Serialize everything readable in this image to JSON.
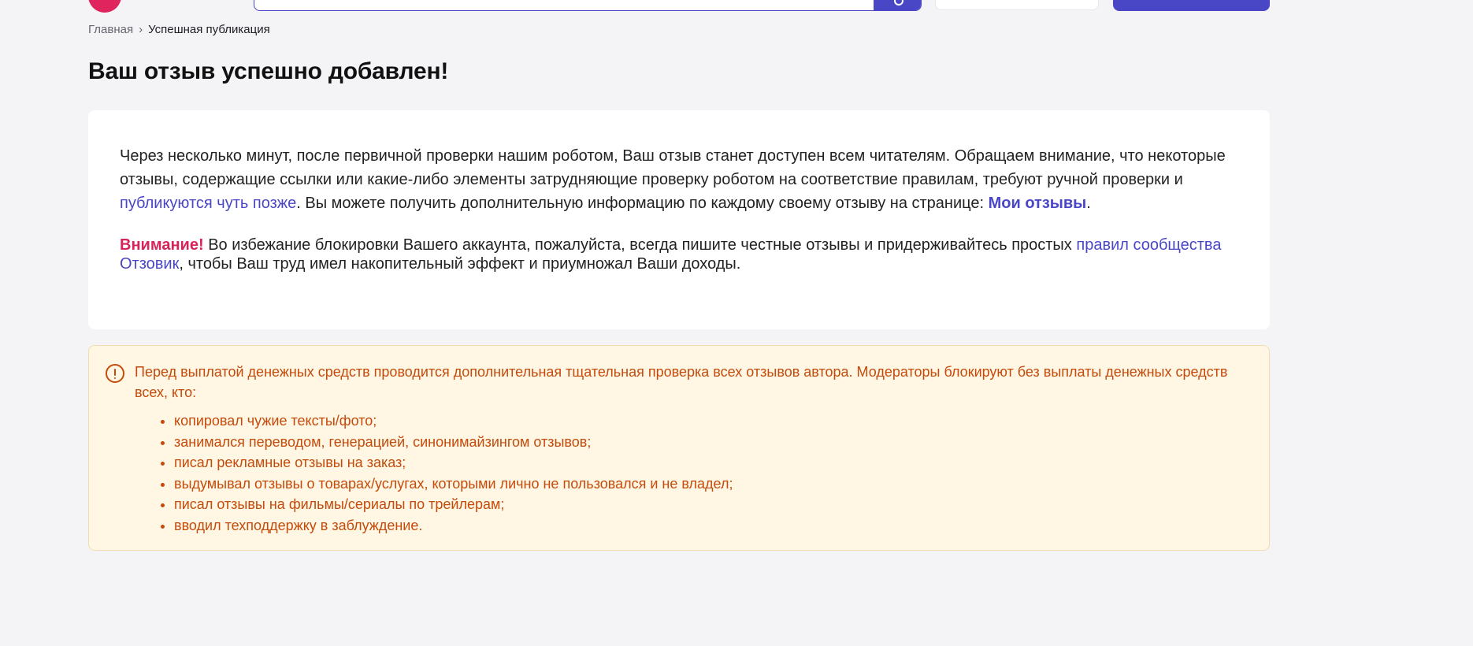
{
  "breadcrumb": {
    "home": "Главная",
    "separator": "›",
    "current": "Успешная публикация"
  },
  "page_title": "Ваш отзыв успешно добавлен!",
  "info": {
    "p1_part1": "Через несколько минут, после первичной проверки нашим роботом, Ваш отзыв станет доступен всем читателям. Обращаем внимание, что некоторые отзывы, содержащие ссылки или какие-либо элементы затрудняющие проверку роботом на соответствие правилам, требуют ручной проверки и ",
    "p1_link": "публикуются чуть позже",
    "p1_part2": ". Вы можете получить дополнительную информацию по каждому своему отзыву на странице: ",
    "my_reviews_link": "Мои отзывы",
    "p1_end": ".",
    "attention_label": "Внимание!",
    "p2_part1": " Во избежание блокировки Вашего аккаунта, пожалуйста, всегда пишите честные отзывы и придерживайтесь простых ",
    "p2_link": "правил сообщества Отзовик",
    "p2_part2": ", чтобы Ваш труд имел накопительный эффект и приумножал Ваши доходы."
  },
  "warning": {
    "icon": "exclamation-circle-icon",
    "text": "Перед выплатой денежных средств проводится дополнительная тщательная проверка всех отзывов автора. Модераторы блокируют без выплаты денежных средств всех, кто:",
    "items": [
      "копировал чужие тексты/фото;",
      "занимался переводом, генерацией, синонимайзингом отзывов;",
      "писал рекламные отзывы на заказ;",
      "выдумывал отзывы о товарах/услугах, которыми лично не пользовался и не владел;",
      "писал отзывы на фильмы/сериалы по трейлерам;",
      "вводил техподдержку в заблуждение."
    ]
  },
  "colors": {
    "accent": "#4a47c7",
    "brand": "#e0245e",
    "attention": "#d6245a",
    "warning_text": "#c44b0c",
    "warning_bg": "#fff6e3"
  }
}
